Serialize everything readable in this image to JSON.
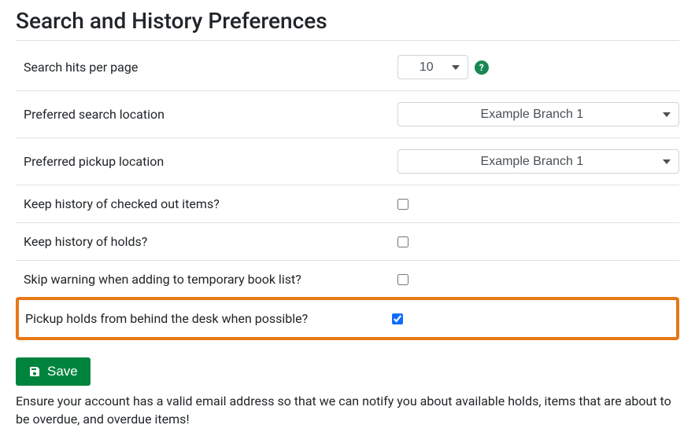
{
  "title": "Search and History Preferences",
  "rows": {
    "hits": {
      "label": "Search hits per page",
      "value": "10"
    },
    "searchLoc": {
      "label": "Preferred search location",
      "value": "Example Branch 1"
    },
    "pickupLoc": {
      "label": "Preferred pickup location",
      "value": "Example Branch 1"
    },
    "historyCheckout": {
      "label": "Keep history of checked out items?"
    },
    "historyHolds": {
      "label": "Keep history of holds?"
    },
    "skipWarning": {
      "label": "Skip warning when adding to temporary book list?"
    },
    "pickupBehind": {
      "label": "Pickup holds from behind the desk when possible?"
    }
  },
  "save": "Save",
  "note": "Ensure your account has a valid email address so that we can notify you about available holds, items that are about to be overdue, and overdue items!",
  "help_glyph": "?"
}
